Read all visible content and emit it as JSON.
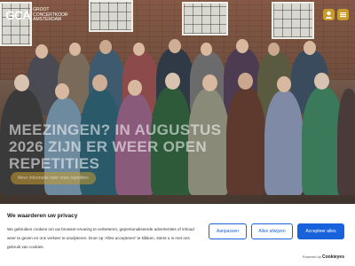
{
  "header": {
    "logo_mark": "GCA",
    "logo_lines": [
      "GROOT",
      "CONCERTKOOR",
      "AMSTERDAM"
    ],
    "icon_left": "user-icon",
    "icon_right": "menu-icon"
  },
  "hero": {
    "headline": "MEEZINGEN? IN AUGUSTUS 2026 ZIJN ER WEER OPEN REPETITIES",
    "button_label": "Meer informatie over onze repetities"
  },
  "cookie_banner": {
    "title": "We waarderen uw privacy",
    "body": "We gebruiken cookies om uw browser-ervaring te verbeteren, gepersonaliseerde advertenties of inhoud weer te geven en ons verkeer te analyseren. Door op 'Alles accepteren' te klikken, stemt u in met ons gebruik van cookies.",
    "customize_label": "Aanpassen",
    "reject_label": "Alles afwijzen",
    "accept_label": "Accepteer alles",
    "powered_prefix": "Powered by",
    "powered_brand": "Cookieyes"
  },
  "colors": {
    "accent": "#1863dc",
    "brand_gold": "#c99a2e"
  }
}
